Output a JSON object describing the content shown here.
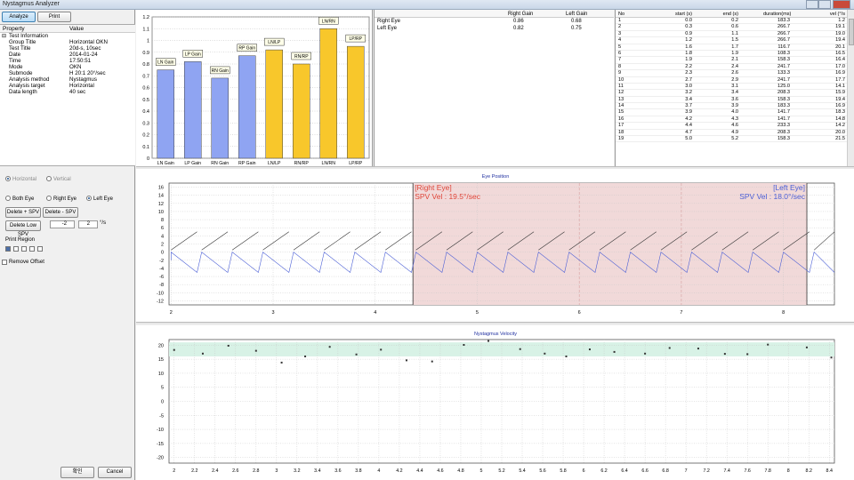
{
  "window": {
    "title": "Nystagmus Analyzer"
  },
  "toolbar": {
    "analyze_label": "Analyze",
    "print_label": "Print"
  },
  "properties": {
    "col_property": "Property",
    "col_value": "Value",
    "group_label": "Test Information",
    "rows": [
      {
        "name": "Group Title",
        "value": "Horizontal OKN"
      },
      {
        "name": "Test Title",
        "value": "20d-s, 10sec"
      },
      {
        "name": "Date",
        "value": "2014-01-24"
      },
      {
        "name": "Time",
        "value": "17:50:51"
      },
      {
        "name": "Mode",
        "value": "OKN"
      },
      {
        "name": "Submode",
        "value": "H 20:1 20°/sec"
      },
      {
        "name": "Analysis method",
        "value": "Nystagmus"
      },
      {
        "name": "Analysis target",
        "value": "Horizontal"
      },
      {
        "name": "Data length",
        "value": "40 sec"
      }
    ]
  },
  "controls": {
    "horizontal_label": "Horizontal",
    "vertical_label": "Vertical",
    "both_eye_label": "Both Eye",
    "right_eye_label": "Right Eye",
    "left_eye_label": "Left Eye",
    "delete_plus_spv_label": "Delete + SPV",
    "delete_minus_spv_label": "Delete - SPV",
    "delete_low_spv_label": "Delete Low SPV",
    "spin_low_value": "-2",
    "spin_high_value": "2",
    "spin_unit": "°/s",
    "print_region_label": "Print Region",
    "print_region_checked": [
      true,
      false,
      false,
      false,
      false
    ],
    "remove_offset_label": "Remove Offset",
    "ok_label": "확인",
    "cancel_label": "Cancel"
  },
  "colors": {
    "bar_blue": "#8fa4f2",
    "bar_yellow": "#f8c72b",
    "right_eye": "#e0463a",
    "left_eye": "#4b5fd6",
    "region_fill": "#f1d9d9",
    "velocity_band": "#d8f2e6",
    "velocity_title": "#2030a0"
  },
  "gain_chart": {
    "chart_data": {
      "type": "bar",
      "categories": [
        "LN Gain",
        "LP Gain",
        "RN Gain",
        "RP Gain",
        "LN/LP",
        "RN/RP",
        "LN/RN",
        "LP/RP"
      ],
      "values": [
        0.75,
        0.82,
        0.68,
        0.87,
        0.92,
        0.8,
        1.1,
        0.95
      ],
      "bar_colors": [
        "blue",
        "blue",
        "blue",
        "blue",
        "yellow",
        "yellow",
        "yellow",
        "yellow"
      ],
      "yticks": [
        "1.2",
        "1.1",
        "1",
        "0.9",
        "0.8",
        "0.7",
        "0.6",
        "0.5",
        "0.4",
        "0.3",
        "0.2",
        "0.1",
        "0"
      ],
      "ylim": [
        0,
        1.2
      ],
      "grid": true
    }
  },
  "gain_table": {
    "headers": [
      "",
      "Right Gain",
      "Left Gain"
    ],
    "rows": [
      [
        "Right Eye",
        "0.86",
        "0.68"
      ],
      [
        "Left Eye",
        "0.82",
        "0.75"
      ]
    ]
  },
  "velocity_table": {
    "headers": [
      "No",
      "start (s)",
      "end (s)",
      "duration(ms)",
      "vel (°/s"
    ],
    "rows": [
      [
        "1",
        "0.0",
        "0.2",
        "183.3",
        "1.2"
      ],
      [
        "2",
        "0.3",
        "0.6",
        "266.7",
        "19.1"
      ],
      [
        "3",
        "0.9",
        "1.1",
        "266.7",
        "19.0"
      ],
      [
        "4",
        "1.2",
        "1.5",
        "266.7",
        "19.4"
      ],
      [
        "5",
        "1.6",
        "1.7",
        "116.7",
        "20.1"
      ],
      [
        "6",
        "1.8",
        "1.9",
        "108.3",
        "16.5"
      ],
      [
        "7",
        "1.9",
        "2.1",
        "158.3",
        "16.4"
      ],
      [
        "8",
        "2.2",
        "2.4",
        "241.7",
        "17.0"
      ],
      [
        "9",
        "2.3",
        "2.6",
        "133.3",
        "16.9"
      ],
      [
        "10",
        "2.7",
        "2.9",
        "241.7",
        "17.7"
      ],
      [
        "11",
        "3.0",
        "3.1",
        "125.0",
        "14.1"
      ],
      [
        "12",
        "3.2",
        "3.4",
        "208.3",
        "15.9"
      ],
      [
        "13",
        "3.4",
        "3.6",
        "158.3",
        "19.4"
      ],
      [
        "14",
        "3.7",
        "3.9",
        "183.3",
        "16.9"
      ],
      [
        "15",
        "3.9",
        "4.0",
        "141.7",
        "18.3"
      ],
      [
        "16",
        "4.2",
        "4.3",
        "141.7",
        "14.8"
      ],
      [
        "17",
        "4.4",
        "4.6",
        "233.3",
        "14.2"
      ],
      [
        "18",
        "4.7",
        "4.9",
        "208.3",
        "20.0"
      ],
      [
        "19",
        "5.0",
        "5.2",
        "158.3",
        "21.5"
      ]
    ]
  },
  "eye_position_chart": {
    "title": "Eye Position",
    "right_eye_label": "[Right Eye]",
    "right_spv_label": "SPV Vel : 19.5°/sec",
    "left_eye_label": "[Left Eye]",
    "left_spv_label": "SPV Vel : 18.0°/sec",
    "chart_data": {
      "type": "line",
      "xlim": [
        1.98,
        8.5
      ],
      "ylim": [
        -13,
        17
      ],
      "xticks": [
        "2",
        "3",
        "4",
        "5",
        "6",
        "7",
        "8"
      ],
      "yticks": [
        "16",
        "14",
        "12",
        "10",
        "8",
        "6",
        "4",
        "2",
        "0",
        "-2",
        "-4",
        "-6",
        "-8",
        "-10",
        "-12"
      ],
      "highlight_region_x": [
        4.37,
        8.23
      ],
      "region_dividers_x": [
        6.0,
        7.0
      ],
      "series": [
        {
          "color": "right",
          "start_x": 2.0,
          "sawtooth": {
            "period": 0.3,
            "low": 5,
            "high": 0,
            "slope_y": 5.0
          }
        },
        {
          "color": "left",
          "start_x": 2.0,
          "sawtooth": {
            "period": 0.3,
            "low": -5,
            "high": 0,
            "slope_y": -5.0
          }
        }
      ]
    }
  },
  "velocity_chart": {
    "title": "Nystagmus Velocity",
    "chart_data": {
      "type": "scatter",
      "xlim": [
        1.95,
        8.45
      ],
      "ylim": [
        -22,
        22
      ],
      "band_y": [
        16,
        21
      ],
      "xticks": [
        "2",
        "2.2",
        "2.4",
        "2.6",
        "2.8",
        "3",
        "3.2",
        "3.4",
        "3.6",
        "3.8",
        "4",
        "4.2",
        "4.4",
        "4.6",
        "4.8",
        "5",
        "5.2",
        "5.4",
        "5.6",
        "5.8",
        "6",
        "6.2",
        "6.4",
        "6.6",
        "6.8",
        "7",
        "7.2",
        "7.4",
        "7.6",
        "7.8",
        "8",
        "8.2",
        "8.4"
      ],
      "yticks": [
        "20",
        "15",
        "10",
        "5",
        "0",
        "-5",
        "-10",
        "-15",
        "-20"
      ],
      "x": [
        2.0,
        2.28,
        2.53,
        2.8,
        3.05,
        3.28,
        3.52,
        3.78,
        4.02,
        4.27,
        4.52,
        4.83,
        5.07,
        5.38,
        5.62,
        5.83,
        6.06,
        6.3,
        6.6,
        6.84,
        7.12,
        7.38,
        7.6,
        7.8,
        8.18,
        8.42
      ],
      "y": [
        18.3,
        17.0,
        19.8,
        18.0,
        13.8,
        16.0,
        19.4,
        16.7,
        18.4,
        14.6,
        14.2,
        20.1,
        21.5,
        18.6,
        17.0,
        16.0,
        18.5,
        17.6,
        17.0,
        19.0,
        18.8,
        16.9,
        16.8,
        20.2,
        19.2,
        15.6
      ]
    }
  }
}
